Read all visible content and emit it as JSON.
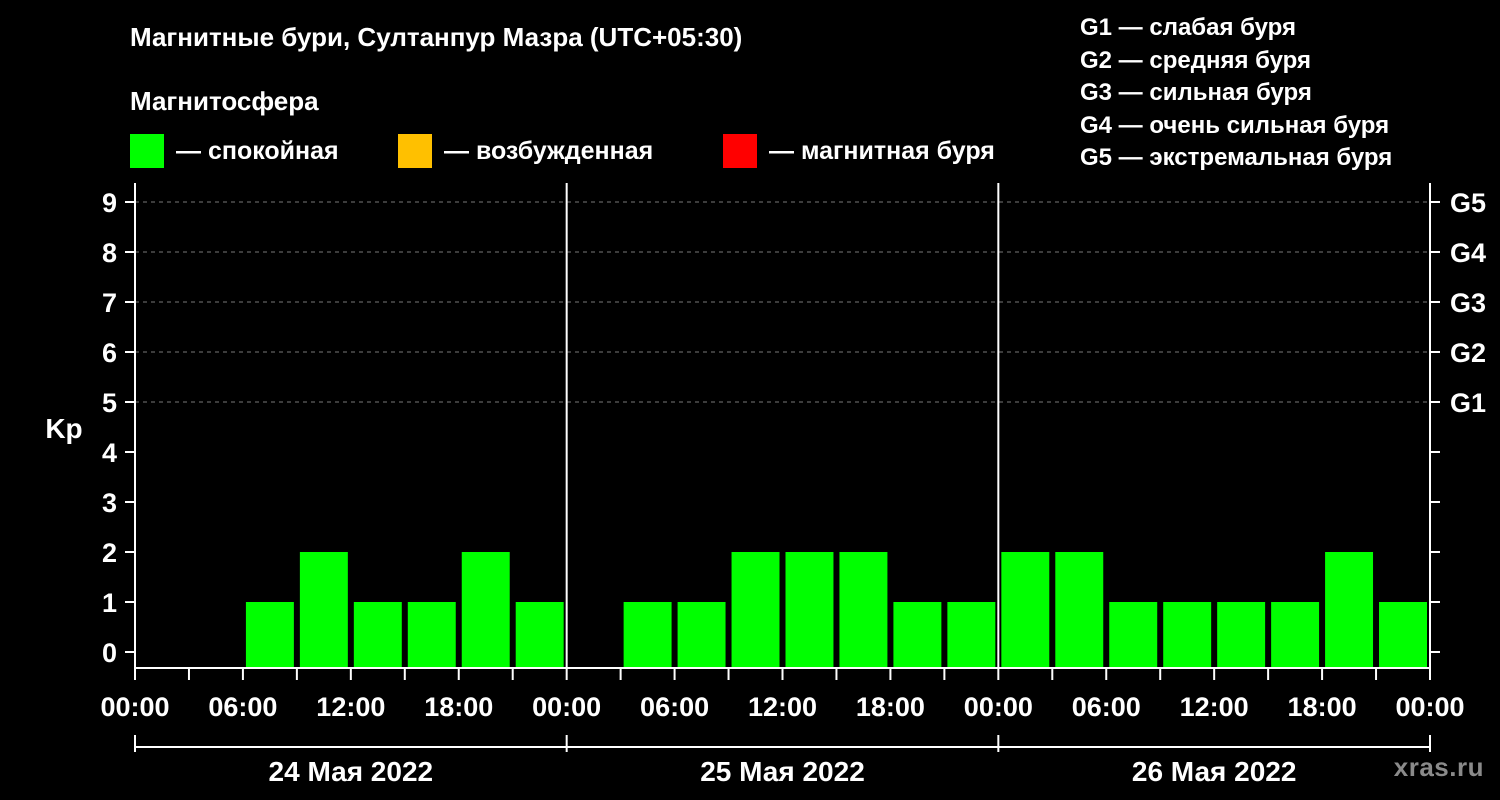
{
  "header": {
    "title": "Магнитные бури, Султанпур Мазра (UTC+05:30)",
    "subtitle": "Магнитосфера"
  },
  "legend": {
    "items": [
      {
        "label": "— спокойная",
        "color": "#00ff00"
      },
      {
        "label": "— возбужденная",
        "color": "#ffc000"
      },
      {
        "label": "— магнитная буря",
        "color": "#ff0000"
      }
    ]
  },
  "g_legend": [
    "G1 — слабая буря",
    "G2 — средняя буря",
    "G3 — сильная буря",
    "G4 — очень сильная буря",
    "G5 — экстремальная буря"
  ],
  "watermark": "xras.ru",
  "chart_data": {
    "type": "bar",
    "ylabel": "Kp",
    "ylim": [
      0,
      9
    ],
    "y_ticks": [
      "0",
      "1",
      "2",
      "3",
      "4",
      "5",
      "6",
      "7",
      "8",
      "9"
    ],
    "right_ticks": [
      {
        "value": 5,
        "label": "G1"
      },
      {
        "value": 6,
        "label": "G2"
      },
      {
        "value": 7,
        "label": "G3"
      },
      {
        "value": 8,
        "label": "G4"
      },
      {
        "value": 9,
        "label": "G5"
      }
    ],
    "x_range_hours": [
      0,
      72
    ],
    "x_tick_labels": [
      "00:00",
      "06:00",
      "12:00",
      "18:00",
      "00:00",
      "06:00",
      "12:00",
      "18:00",
      "00:00",
      "06:00",
      "12:00",
      "18:00",
      "00:00"
    ],
    "days": [
      "24 Мая 2022",
      "25 Мая 2022",
      "26 Мая 2022"
    ],
    "bar_color": "#00ff00",
    "bars": [
      {
        "start": 0,
        "value": 0
      },
      {
        "start": 3,
        "value": 0
      },
      {
        "start": 6,
        "value": 1
      },
      {
        "start": 9,
        "value": 2
      },
      {
        "start": 12,
        "value": 1
      },
      {
        "start": 15,
        "value": 1
      },
      {
        "start": 18,
        "value": 2
      },
      {
        "start": 21,
        "value": 1
      },
      {
        "start": 24,
        "value": 0
      },
      {
        "start": 27,
        "value": 1
      },
      {
        "start": 30,
        "value": 1
      },
      {
        "start": 33,
        "value": 2
      },
      {
        "start": 36,
        "value": 2
      },
      {
        "start": 39,
        "value": 2
      },
      {
        "start": 42,
        "value": 1
      },
      {
        "start": 45,
        "value": 1
      },
      {
        "start": 48,
        "value": 2
      },
      {
        "start": 51,
        "value": 2
      },
      {
        "start": 54,
        "value": 1
      },
      {
        "start": 57,
        "value": 1
      },
      {
        "start": 60,
        "value": 1
      },
      {
        "start": 63,
        "value": 1
      },
      {
        "start": 66,
        "value": 2
      },
      {
        "start": 69,
        "value": 1
      },
      {
        "start": 72,
        "value": 1
      }
    ]
  }
}
